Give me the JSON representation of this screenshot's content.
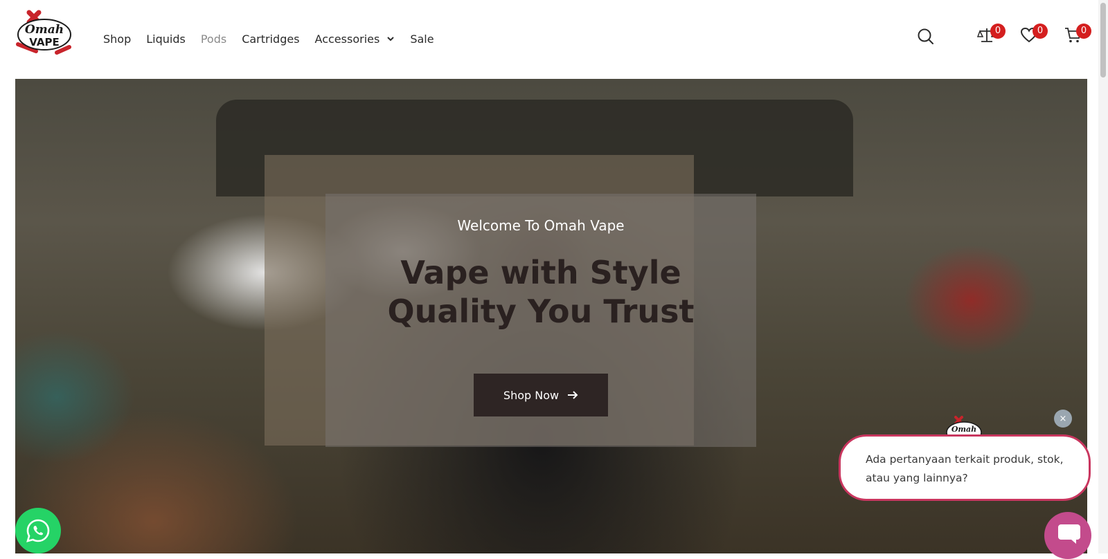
{
  "brand": {
    "logo_top": "Omah",
    "logo_bottom": "VAPE"
  },
  "nav": {
    "items": [
      {
        "label": "Shop"
      },
      {
        "label": "Liquids"
      },
      {
        "label": "Pods"
      },
      {
        "label": "Cartridges"
      },
      {
        "label": "Accessories"
      },
      {
        "label": "Sale"
      }
    ]
  },
  "header_icons": {
    "compare_count": "0",
    "wishlist_count": "0",
    "cart_count": "0"
  },
  "hero": {
    "eyebrow": "Welcome To Omah Vape",
    "title_line1": "Vape with Style",
    "title_line2": "Quality You Trust",
    "cta_label": "Shop Now"
  },
  "chat": {
    "message_line1": "Ada pertanyaan terkait produk, stok,",
    "message_line2": "atau yang lainnya?",
    "close_label": "×"
  },
  "colors": {
    "badge": "#d41f1f",
    "cta": "#2e2524",
    "whatsapp": "#25d366",
    "chat_border": "#c9365f",
    "chat_launcher": "#c34b8c"
  }
}
